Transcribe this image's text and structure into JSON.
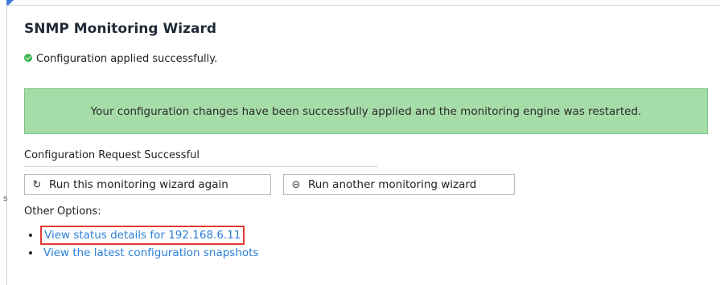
{
  "page": {
    "title": "SNMP Monitoring Wizard",
    "success_message": "Configuration applied successfully.",
    "alert_text": "Your configuration changes have been successfully applied and the monitoring engine was restarted.",
    "section_label": "Configuration Request Successful",
    "side_tick": "s"
  },
  "buttons": {
    "run_again_label": "Run this monitoring wizard again",
    "run_another_label": "Run another monitoring wizard",
    "run_again_icon": "refresh-icon",
    "run_another_icon": "circle-arrow-left-icon"
  },
  "other_options": {
    "label": "Other Options:",
    "items": [
      {
        "label": "View status details for 192.168.6.11"
      },
      {
        "label": "View the latest configuration snapshots"
      }
    ]
  },
  "colors": {
    "alert_background": "#a6dca8",
    "alert_border": "#7cc47f",
    "link": "#2a7fd8",
    "success_icon": "#39b54a",
    "highlight_outline": "#e53935",
    "corner_accent": "#3b7dd8"
  }
}
